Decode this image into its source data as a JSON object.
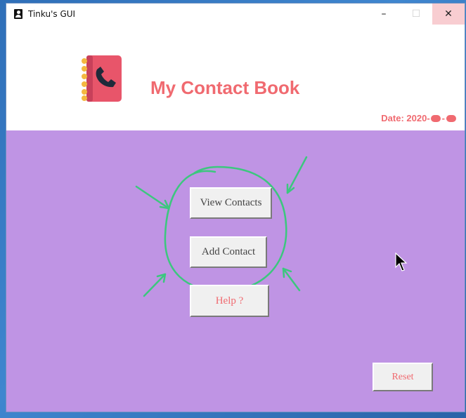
{
  "window": {
    "title": "Tinku's GUI",
    "controls": {
      "minimize": "–",
      "maximize": "☐",
      "close": "✕"
    }
  },
  "header": {
    "title": "My Contact Book",
    "date_label": "Date: 2020-",
    "date_separator": "-",
    "icon": "contact-book-icon"
  },
  "buttons": {
    "view_contacts": "View Contacts",
    "add_contact": "Add Contact",
    "help": "Help ?",
    "reset": "Reset"
  },
  "colors": {
    "accent": "#f06a70",
    "content_bg": "#bf94e4",
    "annotation": "#3cc77e"
  }
}
